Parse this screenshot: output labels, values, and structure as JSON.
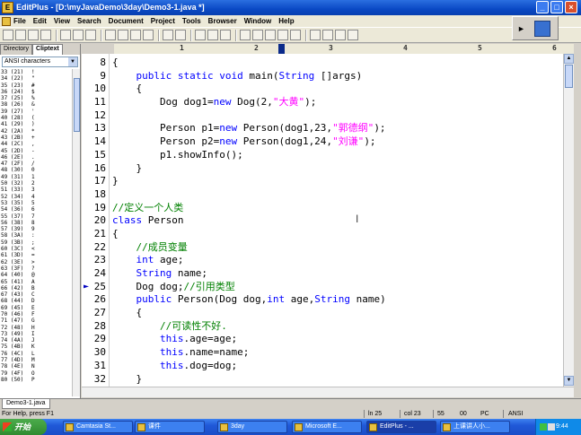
{
  "window": {
    "title": "EditPlus - [D:\\myJavaDemo\\3day\\Demo3-1.java *]",
    "icon": "editplus-icon",
    "minimize": "_",
    "maximize": "□",
    "close": "×"
  },
  "menu": [
    "File",
    "Edit",
    "View",
    "Search",
    "Document",
    "Project",
    "Tools",
    "Browser",
    "Window",
    "Help"
  ],
  "ruler": {
    "marks": [
      "1",
      "2",
      "3",
      "4",
      "5",
      "6"
    ]
  },
  "side_panel": {
    "tabs": [
      "Directory",
      "Cliptext"
    ],
    "active_tab": "Cliptext",
    "selector": "ANSI characters",
    "chars": [
      [
        "33 (21)",
        "!"
      ],
      [
        "34 (22)",
        "\""
      ],
      [
        "35 (23)",
        "#"
      ],
      [
        "36 (24)",
        "$"
      ],
      [
        "37 (25)",
        "%"
      ],
      [
        "38 (26)",
        "&"
      ],
      [
        "39 (27)",
        "'"
      ],
      [
        "40 (28)",
        "("
      ],
      [
        "41 (29)",
        ")"
      ],
      [
        "42 (2A)",
        "*"
      ],
      [
        "43 (2B)",
        "+"
      ],
      [
        "44 (2C)",
        ","
      ],
      [
        "45 (2D)",
        "-"
      ],
      [
        "46 (2E)",
        "."
      ],
      [
        "47 (2F)",
        "/"
      ],
      [
        "48 (30)",
        "0"
      ],
      [
        "49 (31)",
        "1"
      ],
      [
        "50 (32)",
        "2"
      ],
      [
        "51 (33)",
        "3"
      ],
      [
        "52 (34)",
        "4"
      ],
      [
        "53 (35)",
        "5"
      ],
      [
        "54 (36)",
        "6"
      ],
      [
        "55 (37)",
        "7"
      ],
      [
        "56 (38)",
        "8"
      ],
      [
        "57 (39)",
        "9"
      ],
      [
        "58 (3A)",
        ":"
      ],
      [
        "59 (3B)",
        ";"
      ],
      [
        "60 (3C)",
        "<"
      ],
      [
        "61 (3D)",
        "="
      ],
      [
        "62 (3E)",
        ">"
      ],
      [
        "63 (3F)",
        "?"
      ],
      [
        "64 (40)",
        "@"
      ],
      [
        "65 (41)",
        "A"
      ],
      [
        "66 (42)",
        "B"
      ],
      [
        "67 (43)",
        "C"
      ],
      [
        "68 (44)",
        "D"
      ],
      [
        "69 (45)",
        "E"
      ],
      [
        "70 (46)",
        "F"
      ],
      [
        "71 (47)",
        "G"
      ],
      [
        "72 (48)",
        "H"
      ],
      [
        "73 (49)",
        "I"
      ],
      [
        "74 (4A)",
        "J"
      ],
      [
        "75 (4B)",
        "K"
      ],
      [
        "76 (4C)",
        "L"
      ],
      [
        "77 (4D)",
        "M"
      ],
      [
        "78 (4E)",
        "N"
      ],
      [
        "79 (4F)",
        "O"
      ],
      [
        "80 (50)",
        "P"
      ]
    ]
  },
  "editor": {
    "lines": [
      {
        "n": "8",
        "parts": [
          [
            "",
            "{"
          ]
        ]
      },
      {
        "n": "9",
        "parts": [
          [
            "",
            "    "
          ],
          [
            "kw",
            "public static void"
          ],
          [
            "",
            " main("
          ],
          [
            "kw",
            "String"
          ],
          [
            "",
            " []args)"
          ]
        ]
      },
      {
        "n": "10",
        "parts": [
          [
            "",
            "    {"
          ]
        ]
      },
      {
        "n": "11",
        "parts": [
          [
            "",
            "        Dog dog1="
          ],
          [
            "kw",
            "new"
          ],
          [
            "",
            " Dog(2,"
          ],
          [
            "str",
            "\"大黄\""
          ],
          [
            "",
            ");"
          ]
        ]
      },
      {
        "n": "12",
        "parts": [
          [
            "",
            ""
          ]
        ]
      },
      {
        "n": "13",
        "parts": [
          [
            "",
            "        Person p1="
          ],
          [
            "kw",
            "new"
          ],
          [
            "",
            " Person(dog1,23,"
          ],
          [
            "str",
            "\"郭德纲\""
          ],
          [
            "",
            ");"
          ]
        ]
      },
      {
        "n": "14",
        "parts": [
          [
            "",
            "        Person p2="
          ],
          [
            "kw",
            "new"
          ],
          [
            "",
            " Person(dog1,24,"
          ],
          [
            "str",
            "\"刘谦\""
          ],
          [
            "",
            ");"
          ]
        ]
      },
      {
        "n": "15",
        "parts": [
          [
            "",
            "        p1.showInfo();"
          ]
        ]
      },
      {
        "n": "16",
        "parts": [
          [
            "",
            "    }"
          ]
        ]
      },
      {
        "n": "17",
        "parts": [
          [
            "",
            "}"
          ]
        ]
      },
      {
        "n": "18",
        "parts": [
          [
            "",
            ""
          ]
        ]
      },
      {
        "n": "19",
        "parts": [
          [
            "cm",
            "//定义一个人类"
          ]
        ]
      },
      {
        "n": "20",
        "parts": [
          [
            "kw",
            "class"
          ],
          [
            "",
            " Person"
          ]
        ]
      },
      {
        "n": "21",
        "parts": [
          [
            "",
            "{"
          ]
        ]
      },
      {
        "n": "22",
        "parts": [
          [
            "",
            "    "
          ],
          [
            "cm",
            "//成员变量"
          ]
        ]
      },
      {
        "n": "23",
        "parts": [
          [
            "",
            "    "
          ],
          [
            "kw",
            "int"
          ],
          [
            "",
            " age;"
          ]
        ]
      },
      {
        "n": "24",
        "parts": [
          [
            "",
            "    "
          ],
          [
            "kw",
            "String"
          ],
          [
            "",
            " name;"
          ]
        ]
      },
      {
        "n": "25",
        "parts": [
          [
            "",
            "    Dog dog;"
          ],
          [
            "cm",
            "//引用类型"
          ]
        ],
        "marker": true
      },
      {
        "n": "26",
        "parts": [
          [
            "",
            "    "
          ],
          [
            "kw",
            "public"
          ],
          [
            "",
            " Person(Dog dog,"
          ],
          [
            "kw",
            "int"
          ],
          [
            "",
            " age,"
          ],
          [
            "kw",
            "String"
          ],
          [
            "",
            " name)"
          ]
        ]
      },
      {
        "n": "27",
        "parts": [
          [
            "",
            "    {"
          ]
        ]
      },
      {
        "n": "28",
        "parts": [
          [
            "",
            "        "
          ],
          [
            "cm",
            "//可读性不好."
          ]
        ]
      },
      {
        "n": "29",
        "parts": [
          [
            "",
            "        "
          ],
          [
            "kw",
            "this"
          ],
          [
            "",
            ".age=age;"
          ]
        ]
      },
      {
        "n": "30",
        "parts": [
          [
            "",
            "        "
          ],
          [
            "kw",
            "this"
          ],
          [
            "",
            ".name=name;"
          ]
        ]
      },
      {
        "n": "31",
        "parts": [
          [
            "",
            "        "
          ],
          [
            "kw",
            "this"
          ],
          [
            "",
            ".dog=dog;"
          ]
        ]
      },
      {
        "n": "32",
        "parts": [
          [
            "",
            "    }"
          ]
        ]
      }
    ]
  },
  "file_tab": "Demo3-1.java",
  "status": {
    "help": "For Help, press F1",
    "ln": "ln 25",
    "col": "col 23",
    "size": "55",
    "mode": "00",
    "eol": "PC",
    "encoding": "ANSI"
  },
  "taskbar": {
    "start": "开始",
    "tasks": [
      "Camtasia St...",
      "课件",
      "3day",
      "Microsoft E...",
      "EditPlus - ...",
      "上课讲人小..."
    ],
    "active_task": 4,
    "clock": "9:44"
  },
  "colors": {
    "keyword": "#0000ff",
    "string": "#ff00ff",
    "comment": "#008000",
    "titlebar": "#0a49c4"
  }
}
